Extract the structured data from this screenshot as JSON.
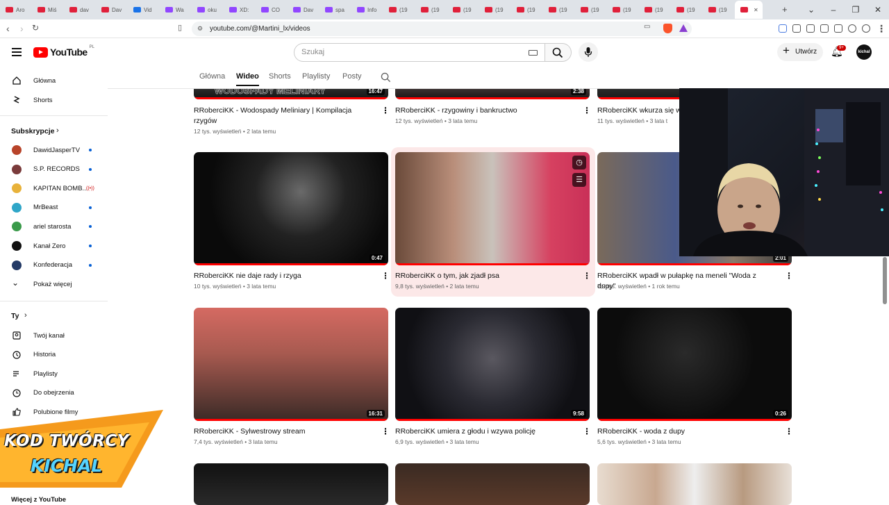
{
  "browser": {
    "tabs": [
      "Aro",
      "Miś",
      "dav",
      "Dav",
      "Vid",
      "Wa",
      "oku",
      "XD:",
      "CO",
      "Dav",
      "spa",
      "Info",
      "(19",
      "(19",
      "(19",
      "(19",
      "(19",
      "(19",
      "(19",
      "(19",
      "(19",
      "(19",
      "(19",
      ""
    ],
    "url": "youtube.com/@Martini_lx/videos"
  },
  "header": {
    "logo": "YouTube",
    "logo_country": "PL",
    "search_placeholder": "Szukaj",
    "create_label": "Utwórz",
    "notifications_badge": "9+",
    "avatar_text": "kichal"
  },
  "sidebar": {
    "main": [
      {
        "label": "Główna",
        "icon": "home-icon"
      },
      {
        "label": "Shorts",
        "icon": "shorts-icon"
      }
    ],
    "subscriptions_heading": "Subskrypcje",
    "subscriptions": [
      {
        "label": "DawidJasperTV",
        "color": "#b8442a",
        "status": "dot"
      },
      {
        "label": "S.P. RECORDS",
        "color": "#7a3b3b",
        "status": "dot"
      },
      {
        "label": "KAPITAN BOMB...",
        "color": "#e8b23a",
        "status": "live"
      },
      {
        "label": "MrBeast",
        "color": "#2fa6c8",
        "status": "dot"
      },
      {
        "label": "ariel starosta",
        "color": "#3a9a4a",
        "status": "dot"
      },
      {
        "label": "Kanał Zero",
        "color": "#111111",
        "status": "dot"
      },
      {
        "label": "Konfederacja",
        "color": "#233a66",
        "status": "dot"
      }
    ],
    "show_more": "Pokaż więcej",
    "you_heading": "Ty",
    "you": [
      {
        "label": "Twój kanał",
        "icon": "channel-icon"
      },
      {
        "label": "Historia",
        "icon": "history-icon"
      },
      {
        "label": "Playlisty",
        "icon": "playlist-icon"
      },
      {
        "label": "Do obejrzenia",
        "icon": "watch-later-icon"
      },
      {
        "label": "Polubione filmy",
        "icon": "like-icon"
      }
    ],
    "more_heading": "Więcej z YouTube"
  },
  "channel_tabs": [
    "Główna",
    "Wideo",
    "Shorts",
    "Playlisty",
    "Posty"
  ],
  "videos": [
    {
      "title": "RRoberciKK - Wodospady Meliniary | Kompilacja rzygów",
      "meta": "12 tys. wyświetleń • 2 lata temu",
      "duration": "16:47"
    },
    {
      "title": "RRoberciKK - rzygowiny i bankructwo",
      "meta": "12 tys. wyświetleń • 3 lata temu",
      "duration": "2:38"
    },
    {
      "title": "RRoberciKK wkurza się w",
      "meta": "11 tys. wyświetleń • 3 lata t",
      "duration": ""
    },
    {
      "title": "RRoberciKK nie daje rady i rzyga",
      "meta": "10 tys. wyświetleń • 3 lata temu",
      "duration": "0:47"
    },
    {
      "title": "RRoberciKK o tym, jak zjadł psa",
      "meta": "9,8 tys. wyświetleń • 2 lata temu",
      "duration": ""
    },
    {
      "title": "RRoberciKK wpadł w pułapkę na meneli \"Woda z dupy\"",
      "meta": "7,9 tys. wyświetleń • 1 rok temu",
      "duration": "2:01"
    },
    {
      "title": "RRoberciKK - Sylwestrowy stream",
      "meta": "7,4 tys. wyświetleń • 3 lata temu",
      "duration": "16:31"
    },
    {
      "title": "RRoberciKK umiera z głodu i wzywa policję",
      "meta": "6,9 tys. wyświetleń • 3 lata temu",
      "duration": "9:58"
    },
    {
      "title": "RRoberciKK - woda z dupy",
      "meta": "5,6 tys. wyświetleń • 3 lata temu",
      "duration": "0:26"
    }
  ],
  "thumb_top_text": "WODOSPADY MELINIARY",
  "promo": {
    "line1": "KOD TWÓRCY",
    "line2": "KICHAL"
  }
}
